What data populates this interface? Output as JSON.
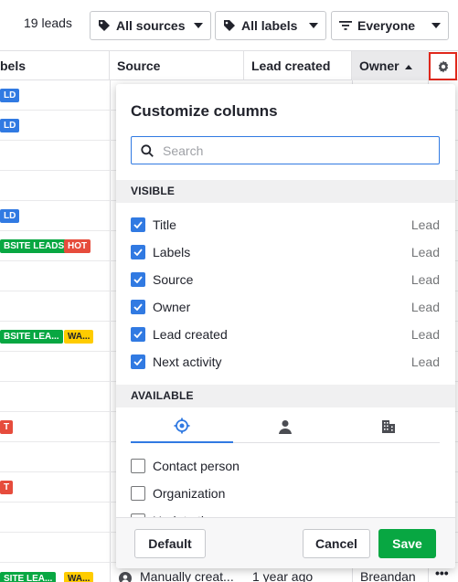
{
  "toolbar": {
    "leads_count": "19 leads",
    "sources_label": "All sources",
    "labels_label": "All labels",
    "owner_filter_label": "Everyone"
  },
  "table": {
    "columns": [
      "bels",
      "Source",
      "Lead created",
      "Owner"
    ],
    "rows": [
      {
        "badges": [
          {
            "text": "LD",
            "color": "blue"
          }
        ]
      },
      {
        "badges": [
          {
            "text": "LD",
            "color": "blue"
          }
        ]
      },
      {
        "badges": []
      },
      {
        "badges": []
      },
      {
        "badges": [
          {
            "text": "LD",
            "color": "blue"
          }
        ]
      },
      {
        "badges": [
          {
            "text": "BSITE LEADS",
            "color": "green"
          },
          {
            "text": "HOT",
            "color": "red"
          }
        ]
      },
      {
        "badges": []
      },
      {
        "badges": []
      },
      {
        "badges": [
          {
            "text": "BSITE LEA...",
            "color": "green"
          },
          {
            "text": "WA...",
            "color": "yellow"
          }
        ]
      },
      {
        "badges": []
      },
      {
        "badges": []
      },
      {
        "badges": [
          {
            "text": "T",
            "color": "red"
          }
        ]
      },
      {
        "badges": []
      },
      {
        "badges": [
          {
            "text": "T",
            "color": "red"
          }
        ]
      },
      {
        "badges": []
      },
      {
        "badges": []
      }
    ],
    "bottom_row": {
      "badges": [
        {
          "text": "SITE LEA...",
          "color": "green"
        },
        {
          "text": "WA...",
          "color": "yellow"
        }
      ],
      "source": "Manually creat...",
      "created": "1 year ago",
      "owner": "Breandan"
    }
  },
  "popover": {
    "title": "Customize columns",
    "search_placeholder": "Search",
    "visible_header": "VISIBLE",
    "available_header": "AVAILABLE",
    "visible": [
      {
        "name": "Title",
        "source": "Lead"
      },
      {
        "name": "Labels",
        "source": "Lead"
      },
      {
        "name": "Source",
        "source": "Lead"
      },
      {
        "name": "Owner",
        "source": "Lead"
      },
      {
        "name": "Lead created",
        "source": "Lead"
      },
      {
        "name": "Next activity",
        "source": "Lead"
      }
    ],
    "available": [
      {
        "name": "Contact person"
      },
      {
        "name": "Organization"
      },
      {
        "name": "Update time"
      }
    ],
    "tabs": [
      "target-icon",
      "person-icon",
      "building-icon"
    ],
    "default_label": "Default",
    "cancel_label": "Cancel",
    "save_label": "Save"
  },
  "colors": {
    "accent": "#317ae2",
    "save": "#08a742",
    "highlight_border": "#e0271b"
  }
}
